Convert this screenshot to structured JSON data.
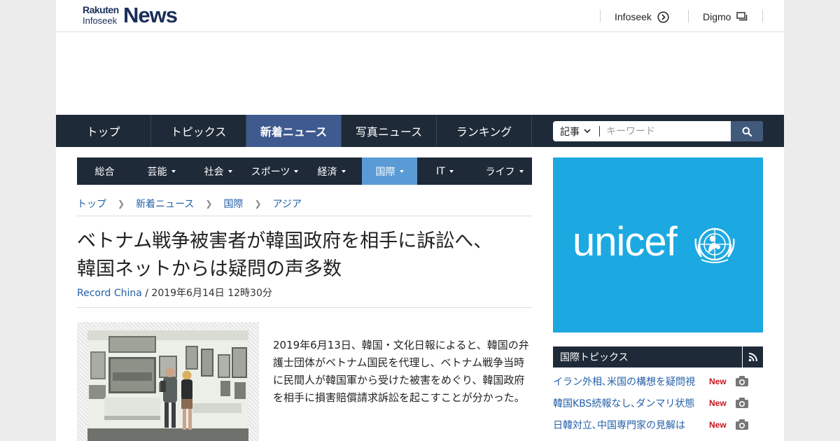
{
  "header": {
    "logo_small_1": "Rakuten",
    "logo_small_2": "Infoseek",
    "logo_big": "News",
    "links": [
      {
        "label": "Infoseek",
        "icon": "arrow-circle-right-icon"
      },
      {
        "label": "Digmo",
        "icon": "windows-icon"
      }
    ]
  },
  "main_nav": {
    "items": [
      "トップ",
      "トピックス",
      "新着ニュース",
      "写真ニュース",
      "ランキング"
    ],
    "active": "新着ニュース"
  },
  "search": {
    "category": "記事",
    "placeholder": "キーワード",
    "button_icon": "search-icon"
  },
  "sub_nav": {
    "items": [
      "総合",
      "芸能",
      "社会",
      "スポーツ",
      "経済",
      "国際",
      "IT",
      "ライフ"
    ],
    "active": "国際",
    "active_color": "#5a9bd5"
  },
  "breadcrumb": [
    "トップ",
    "新着ニュース",
    "国際",
    "アジア"
  ],
  "article": {
    "title_line1": "ベトナム戦争被害者が韓国政府を相手に訴訟へ、",
    "title_line2": "韓国ネットからは疑問の声多数",
    "source": "Record China",
    "date": " / 2019年6月14日 12時30分",
    "body": "2019年6月13日、韓国・文化日報によると、韓国の弁護士団体がベトナム国民を代理し、ベトナム戦争当時に民間人が韓国軍から受けた被害をめぐり、韓国政府を相手に損害賠償請求訴訟を起こすことが分かった。"
  },
  "ad": {
    "text": "unicef",
    "color": "#1ca9e1",
    "emblem": "unicef-emblem-icon"
  },
  "topics": {
    "title": "国際トピックス",
    "icon": "rss-icon",
    "items": [
      {
        "title": "イラン外相､米国の構想を疑問視",
        "badge": "New",
        "icon": "camera-icon"
      },
      {
        "title": "韓国KBS続報なし､ダンマリ状態",
        "badge": "New",
        "icon": "camera-icon"
      },
      {
        "title": "日韓対立､中国専門家の見解は",
        "badge": "New",
        "icon": "camera-icon"
      }
    ]
  },
  "colors": {
    "nav_bg": "#1f2a38",
    "nav_active": "#3e5a8f",
    "link": "#2560a8",
    "new_badge": "#c4161c"
  }
}
